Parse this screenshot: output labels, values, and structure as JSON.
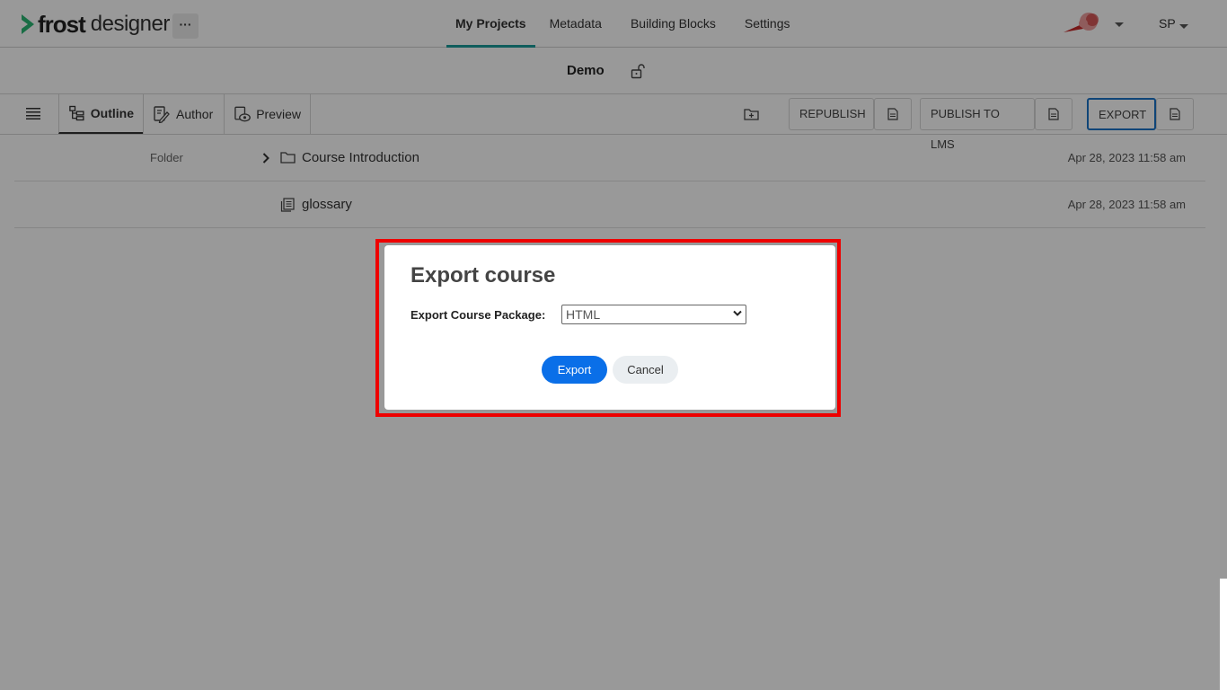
{
  "header": {
    "brand_bold": "frost",
    "brand_light": "designer",
    "more_label": "···",
    "nav": [
      {
        "label": "My Projects",
        "active": true
      },
      {
        "label": "Metadata"
      },
      {
        "label": "Building Blocks"
      },
      {
        "label": "Settings"
      }
    ],
    "user_initials": "SP"
  },
  "project": {
    "title": "Demo"
  },
  "toolbar": {
    "tabs": [
      {
        "label": "Outline",
        "active": true
      },
      {
        "label": "Author"
      },
      {
        "label": "Preview"
      }
    ],
    "republish_label": "REPUBLISH",
    "publish_lms_label": "PUBLISH TO LMS",
    "export_label": "EXPORT"
  },
  "rows": [
    {
      "type": "Folder",
      "name": "Course Introduction",
      "date": "Apr 28, 2023 11:58 am"
    },
    {
      "type": "",
      "name": "glossary",
      "date": "Apr 28, 2023 11:58 am"
    }
  ],
  "dialog": {
    "title": "Export course",
    "package_label": "Export Course Package:",
    "package_value": "HTML",
    "export_label": "Export",
    "cancel_label": "Cancel"
  },
  "colors": {
    "accent_teal": "#1a9c9a",
    "primary_blue": "#0a6fe8",
    "highlight_red": "#ee0000",
    "logo_green": "#2bb673"
  }
}
